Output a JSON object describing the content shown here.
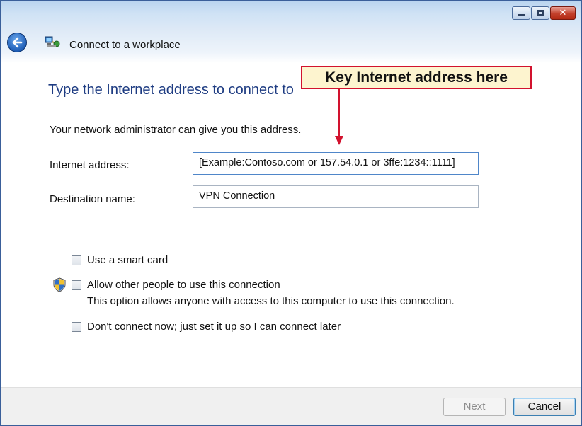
{
  "window": {
    "wizard_title": "Connect to a workplace",
    "close_glyph": "✕"
  },
  "page": {
    "heading": "Type the Internet address to connect to",
    "intro": "Your network administrator can give you this address."
  },
  "fields": {
    "internet_address": {
      "label": "Internet address:",
      "value": "[Example:Contoso.com or 157.54.0.1 or 3ffe:1234::1111]"
    },
    "destination_name": {
      "label": "Destination name:",
      "value": "VPN Connection"
    }
  },
  "options": [
    {
      "label": "Use a smart card",
      "checked": false
    },
    {
      "label": "Allow other people to use this connection",
      "checked": false,
      "note": "This option allows anyone with access to this computer to use this connection."
    },
    {
      "label": "Don't connect now; just set it up so I can connect later",
      "checked": false
    }
  ],
  "buttons": {
    "next": "Next",
    "cancel": "Cancel"
  },
  "callout": {
    "text": "Key Internet address here"
  },
  "icons": {
    "back": "back-arrow-icon",
    "network": "network-connection-icon",
    "shield": "uac-shield-icon"
  },
  "colors": {
    "heading": "#1e3c82",
    "callout_border": "#d2122e",
    "callout_fill": "#fdf4cf"
  }
}
